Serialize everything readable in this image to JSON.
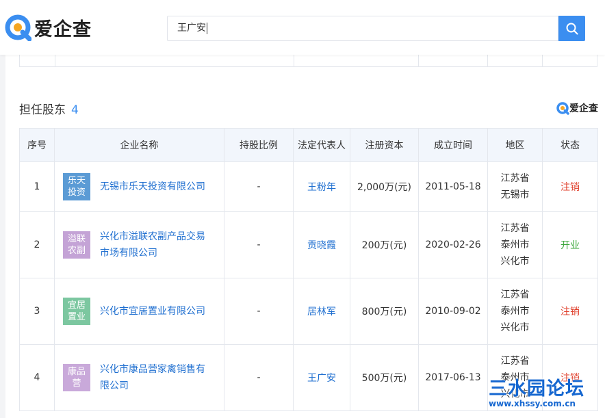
{
  "header": {
    "brand": "爱企查",
    "search_value": "王广安"
  },
  "section": {
    "title": "担任股东",
    "count": "4",
    "brand_small": "爱企查"
  },
  "table": {
    "columns": [
      "序号",
      "企业名称",
      "持股比例",
      "法定代表人",
      "注册资本",
      "成立时间",
      "地区",
      "状态"
    ],
    "rows": [
      {
        "index": "1",
        "badge_line1": "乐天",
        "badge_line2": "投资",
        "badge_color": "#5b9bd5",
        "company": "无锡市乐天投资有限公司",
        "share_ratio": "-",
        "legal_rep": "王粉年",
        "capital": "2,000万(元)",
        "founded": "2011-05-18",
        "region_line1": "江苏省",
        "region_line2": "无锡市",
        "region_line3": "",
        "status": "注销",
        "status_color": "#e0402c"
      },
      {
        "index": "2",
        "badge_line1": "溢联",
        "badge_line2": "农副",
        "badge_color": "#c4a3d6",
        "company_line1": "兴化市溢联农副产品交易",
        "company_line2": "市场有限公司",
        "share_ratio": "-",
        "legal_rep": "贡晓霞",
        "capital": "200万(元)",
        "founded": "2020-02-26",
        "region_line1": "江苏省",
        "region_line2": "泰州市",
        "region_line3": "兴化市",
        "status": "开业",
        "status_color": "#3aa63a"
      },
      {
        "index": "3",
        "badge_line1": "宜居",
        "badge_line2": "置业",
        "badge_color": "#7cc7a0",
        "company": "兴化市宜居置业有限公司",
        "share_ratio": "-",
        "legal_rep": "居林军",
        "capital": "800万(元)",
        "founded": "2010-09-02",
        "region_line1": "江苏省",
        "region_line2": "泰州市",
        "region_line3": "兴化市",
        "status": "注销",
        "status_color": "#e0402c"
      },
      {
        "index": "4",
        "badge_line1": "康品",
        "badge_line2": "营",
        "badge_color": "#c9a9da",
        "company_line1": "兴化市康品营家禽销售有",
        "company_line2": "限公司",
        "share_ratio": "-",
        "legal_rep": "王广安",
        "capital": "500万(元)",
        "founded": "2017-06-13",
        "region_line1": "江苏省",
        "region_line2": "泰州市",
        "region_line3": "兴化市",
        "status": "注销",
        "status_color": "#e0402c"
      }
    ]
  },
  "watermark": {
    "title": "三水园论坛",
    "url": "www.xhssy.com.cn"
  },
  "colors": {
    "accent": "#3b8ef0",
    "link": "#1f6fd0",
    "header_bg": "#f2f6fc"
  }
}
